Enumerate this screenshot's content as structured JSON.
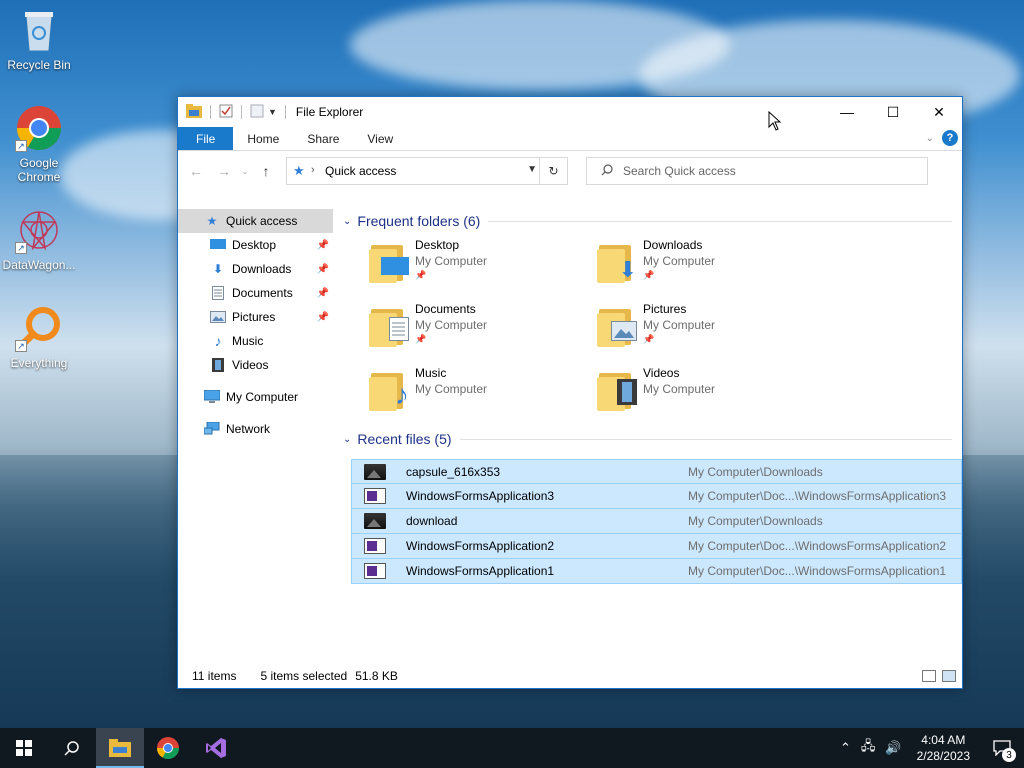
{
  "desktop": {
    "icons": [
      {
        "label": "Recycle Bin",
        "icon": "recycle-bin-icon"
      },
      {
        "label": "Google Chrome",
        "icon": "chrome-icon"
      },
      {
        "label": "DataWagon...",
        "icon": "datawagon-icon"
      },
      {
        "label": "Everything",
        "icon": "everything-search-icon"
      }
    ]
  },
  "window": {
    "title": "File Explorer",
    "controls": {
      "minimize": "—",
      "maximize": "☐",
      "close": "✕"
    },
    "ribbon_tabs": [
      {
        "label": "File"
      },
      {
        "label": "Home"
      },
      {
        "label": "Share"
      },
      {
        "label": "View"
      }
    ],
    "help_label": "?",
    "address": {
      "crumb": "Quick access"
    },
    "search": {
      "placeholder": "Search Quick access"
    },
    "nav_pane": {
      "quick_access": "Quick access",
      "pinned": [
        {
          "label": "Desktop",
          "icon": "desktop-icon"
        },
        {
          "label": "Downloads",
          "icon": "downloads-icon"
        },
        {
          "label": "Documents",
          "icon": "documents-icon"
        },
        {
          "label": "Pictures",
          "icon": "pictures-icon"
        },
        {
          "label": "Music",
          "icon": "music-icon"
        },
        {
          "label": "Videos",
          "icon": "videos-icon"
        }
      ],
      "my_computer": "My Computer",
      "network": "Network"
    },
    "frequent": {
      "header": "Frequent folders (6)",
      "folders": [
        {
          "name": "Desktop",
          "location": "My Computer",
          "pinned": true,
          "glyph": "desktop-overlay-icon"
        },
        {
          "name": "Downloads",
          "location": "My Computer",
          "pinned": true,
          "glyph": "downloads-overlay-icon"
        },
        {
          "name": "Documents",
          "location": "My Computer",
          "pinned": true,
          "glyph": "documents-overlay-icon"
        },
        {
          "name": "Pictures",
          "location": "My Computer",
          "pinned": true,
          "glyph": "pictures-overlay-icon"
        },
        {
          "name": "Music",
          "location": "My Computer",
          "pinned": false,
          "glyph": "music-overlay-icon"
        },
        {
          "name": "Videos",
          "location": "My Computer",
          "pinned": false,
          "glyph": "videos-overlay-icon"
        }
      ]
    },
    "recent": {
      "header": "Recent files (5)",
      "files": [
        {
          "name": "capsule_616x353",
          "path": "My Computer\\Downloads",
          "type": "image"
        },
        {
          "name": "WindowsFormsApplication3",
          "path": "My Computer\\Doc...\\WindowsFormsApplication3",
          "type": "vs"
        },
        {
          "name": "download",
          "path": "My Computer\\Downloads",
          "type": "image"
        },
        {
          "name": "WindowsFormsApplication2",
          "path": "My Computer\\Doc...\\WindowsFormsApplication2",
          "type": "vs"
        },
        {
          "name": "WindowsFormsApplication1",
          "path": "My Computer\\Doc...\\WindowsFormsApplication1",
          "type": "vs"
        }
      ]
    },
    "status": {
      "items": "11 items",
      "selected": "5 items selected",
      "size": "51.8 KB"
    }
  },
  "taskbar": {
    "apps": [
      {
        "icon": "start-icon"
      },
      {
        "icon": "search-icon"
      },
      {
        "icon": "file-explorer-icon",
        "active": true
      },
      {
        "icon": "chrome-icon"
      },
      {
        "icon": "visual-studio-icon"
      }
    ],
    "time": "4:04 AM",
    "date": "2/28/2023",
    "notification_count": "3"
  },
  "colors": {
    "accent": "#1979ca",
    "selection_bg": "#cce8ff",
    "selection_border": "#99d1ff",
    "group_header": "#1e3287"
  }
}
